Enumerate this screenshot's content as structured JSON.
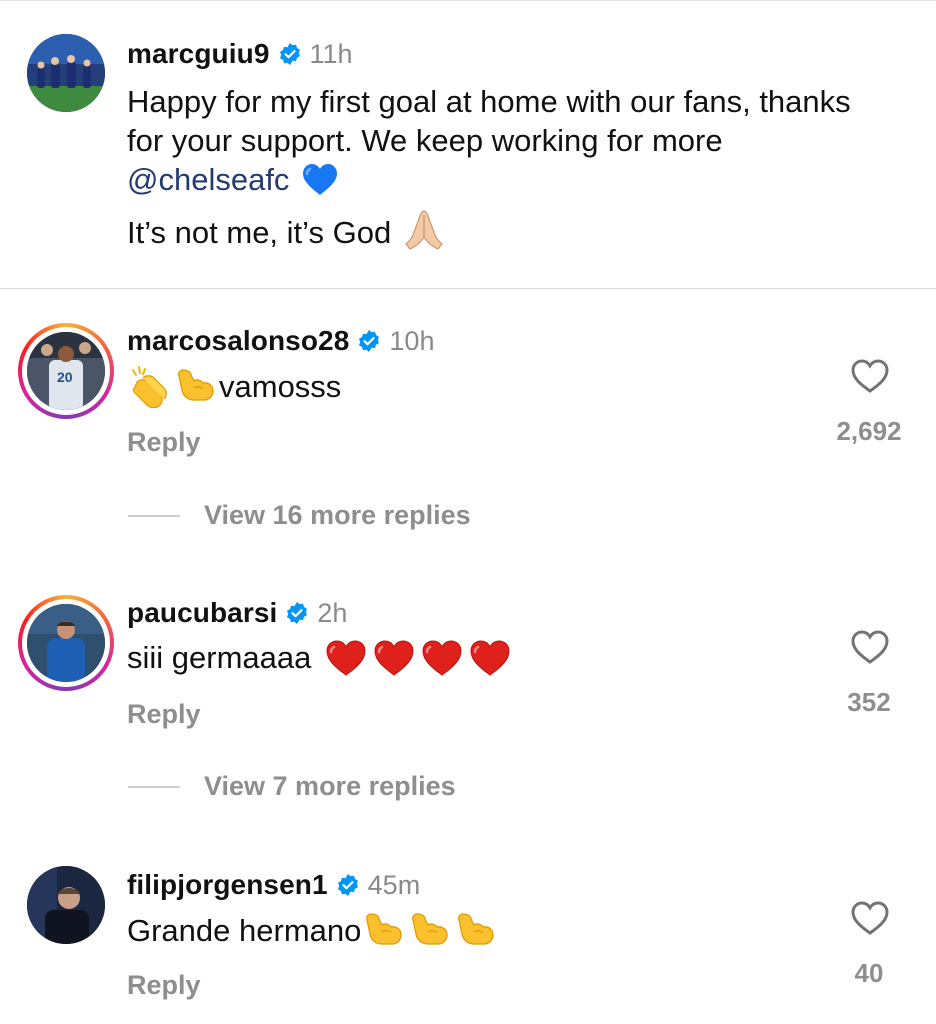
{
  "post": {
    "username": "marcguiu9",
    "time": "11h",
    "caption_line1_prefix": "Happy for my first goal at home with our fans, thanks for your support. We keep working for more ",
    "mention": "@chelseafc",
    "caption_line2": "It’s not me, it’s God",
    "emojis_line1": [
      "blue-heart"
    ],
    "emojis_line2": [
      "folded-hands"
    ]
  },
  "comments": [
    {
      "username": "marcosalonso28",
      "time": "10h",
      "text": "vamosss",
      "emojis_before": [
        "clapping-hands",
        "flexed-biceps"
      ],
      "likes": "2,692",
      "reply_label": "Reply",
      "view_replies": "View 16 more replies",
      "story_ring": true
    },
    {
      "username": "paucubarsi",
      "time": "2h",
      "text": "siii germaaaa",
      "emojis_after": [
        "red-heart",
        "red-heart",
        "red-heart",
        "red-heart"
      ],
      "likes": "352",
      "reply_label": "Reply",
      "view_replies": "View 7 more replies",
      "story_ring": true
    },
    {
      "username": "filipjorgensen1",
      "time": "45m",
      "text": "Grande hermano",
      "emojis_after": [
        "flexed-biceps",
        "flexed-biceps",
        "flexed-biceps"
      ],
      "likes": "40",
      "reply_label": "Reply",
      "story_ring": false
    }
  ],
  "colors": {
    "verified": "#0095f6",
    "secondary_text": "#8e8e8e",
    "mention": "#243b70"
  }
}
